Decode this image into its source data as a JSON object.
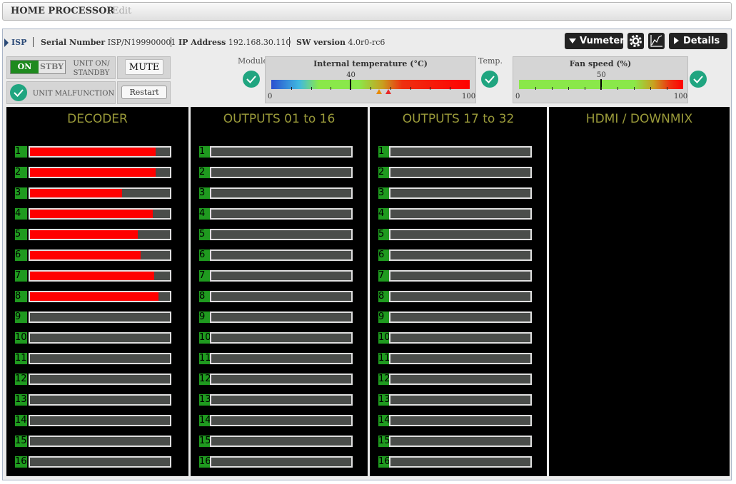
{
  "header": {
    "title": "HOME PROCESSOR",
    "edit": "Edit"
  },
  "info": {
    "device": "ISP",
    "serial_label": "Serial Number",
    "serial_value": "ISP/N199900001",
    "ip_label": "IP Address",
    "ip_value": "192.168.30.110",
    "sw_label": "SW version",
    "sw_value": "4.0r0-rc6"
  },
  "toolbar": {
    "vumeter": "Vumeter",
    "details": "Details"
  },
  "controls": {
    "on": "ON",
    "stby": "STBY",
    "unit_on_standby_line1": "UNIT ON/",
    "unit_on_standby_line2": "STANDBY",
    "mute": "MUTE",
    "unit_malfunction": "UNIT MALFUNCTION",
    "restart": "Restart"
  },
  "status": {
    "module_label": "Module",
    "temp_label": "Temp."
  },
  "temperature": {
    "title": "Internal temperature (°C)",
    "value": 40,
    "value_label": "40",
    "min_label": "0",
    "max_label": "100",
    "warning_marker_color": "#e88a00",
    "alarm_marker_color": "#e82a2a"
  },
  "fan": {
    "title": "Fan speed (%)",
    "value": 50,
    "value_label": "50",
    "min_label": "0",
    "max_label": "100"
  },
  "colors": {
    "accent_green": "#1f9a1f",
    "status_ok": "#20a580",
    "meter_red": "#ff0000",
    "heading_olive": "#9b9b3a"
  },
  "columns": [
    {
      "title": "DECODER",
      "levels": [
        0.9,
        0.9,
        0.66,
        0.88,
        0.77,
        0.79,
        0.89,
        0.92,
        0,
        0,
        0,
        0,
        0,
        0,
        0,
        0
      ]
    },
    {
      "title": "OUTPUTS 01 to 16",
      "levels": [
        0,
        0,
        0,
        0,
        0,
        0,
        0,
        0,
        0,
        0,
        0,
        0,
        0,
        0,
        0,
        0
      ]
    },
    {
      "title": "OUTPUTS 17 to 32",
      "levels": [
        0,
        0,
        0,
        0,
        0,
        0,
        0,
        0,
        0,
        0,
        0,
        0,
        0,
        0,
        0,
        0
      ]
    },
    {
      "title": "HDMI / DOWNMIX",
      "levels": []
    }
  ],
  "channel_labels": [
    "1",
    "2",
    "3",
    "4",
    "5",
    "6",
    "7",
    "8",
    "9",
    "10",
    "11",
    "12",
    "13",
    "14",
    "15",
    "16"
  ]
}
